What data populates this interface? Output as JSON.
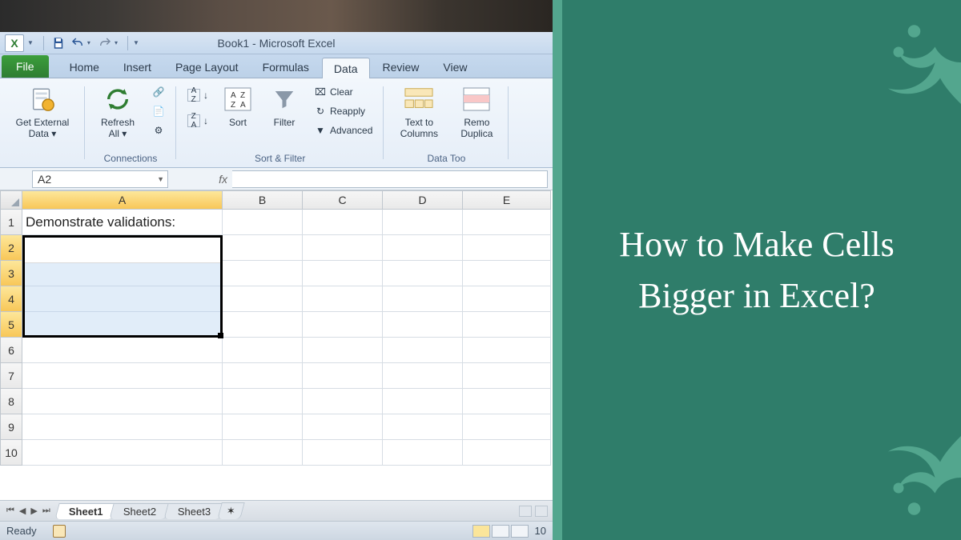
{
  "window": {
    "title": "Book1  -  Microsoft Excel"
  },
  "qat": {
    "logo_letter": "X"
  },
  "tabs": {
    "file": "File",
    "items": [
      "Home",
      "Insert",
      "Page Layout",
      "Formulas",
      "Data",
      "Review",
      "View"
    ],
    "active_index": 4
  },
  "ribbon": {
    "get_external_data": {
      "label": "Get External\nData ▾",
      "group": ""
    },
    "connections": {
      "refresh_all": "Refresh\nAll ▾",
      "group_label": "Connections"
    },
    "sort_filter": {
      "sort_asc": "A→Z",
      "sort_desc": "Z→A",
      "sort": "Sort",
      "filter": "Filter",
      "clear": "Clear",
      "reapply": "Reapply",
      "advanced": "Advanced",
      "group_label": "Sort & Filter"
    },
    "data_tools": {
      "text_to_columns": "Text to\nColumns",
      "remove_duplicates": "Remo\nDuplica",
      "group_label": "Data Too"
    }
  },
  "name_box": {
    "value": "A2"
  },
  "formula_bar": {
    "fx_label": "fx",
    "value": ""
  },
  "columns": [
    "A",
    "B",
    "C",
    "D",
    "E"
  ],
  "rows_visible": [
    1,
    2,
    3,
    4,
    5,
    6,
    7,
    8,
    9,
    10
  ],
  "cells": {
    "A1": "Demonstrate validations:"
  },
  "selection": {
    "active": "A2",
    "range": "A2:A5",
    "selected_rows": [
      2,
      3,
      4,
      5
    ],
    "selected_cols": [
      "A"
    ]
  },
  "sheet_tabs": {
    "items": [
      "Sheet1",
      "Sheet2",
      "Sheet3"
    ],
    "active_index": 0
  },
  "status_bar": {
    "ready": "Ready",
    "zoom": "10"
  },
  "right_panel": {
    "title": "How to Make Cells Bigger in Excel?"
  }
}
